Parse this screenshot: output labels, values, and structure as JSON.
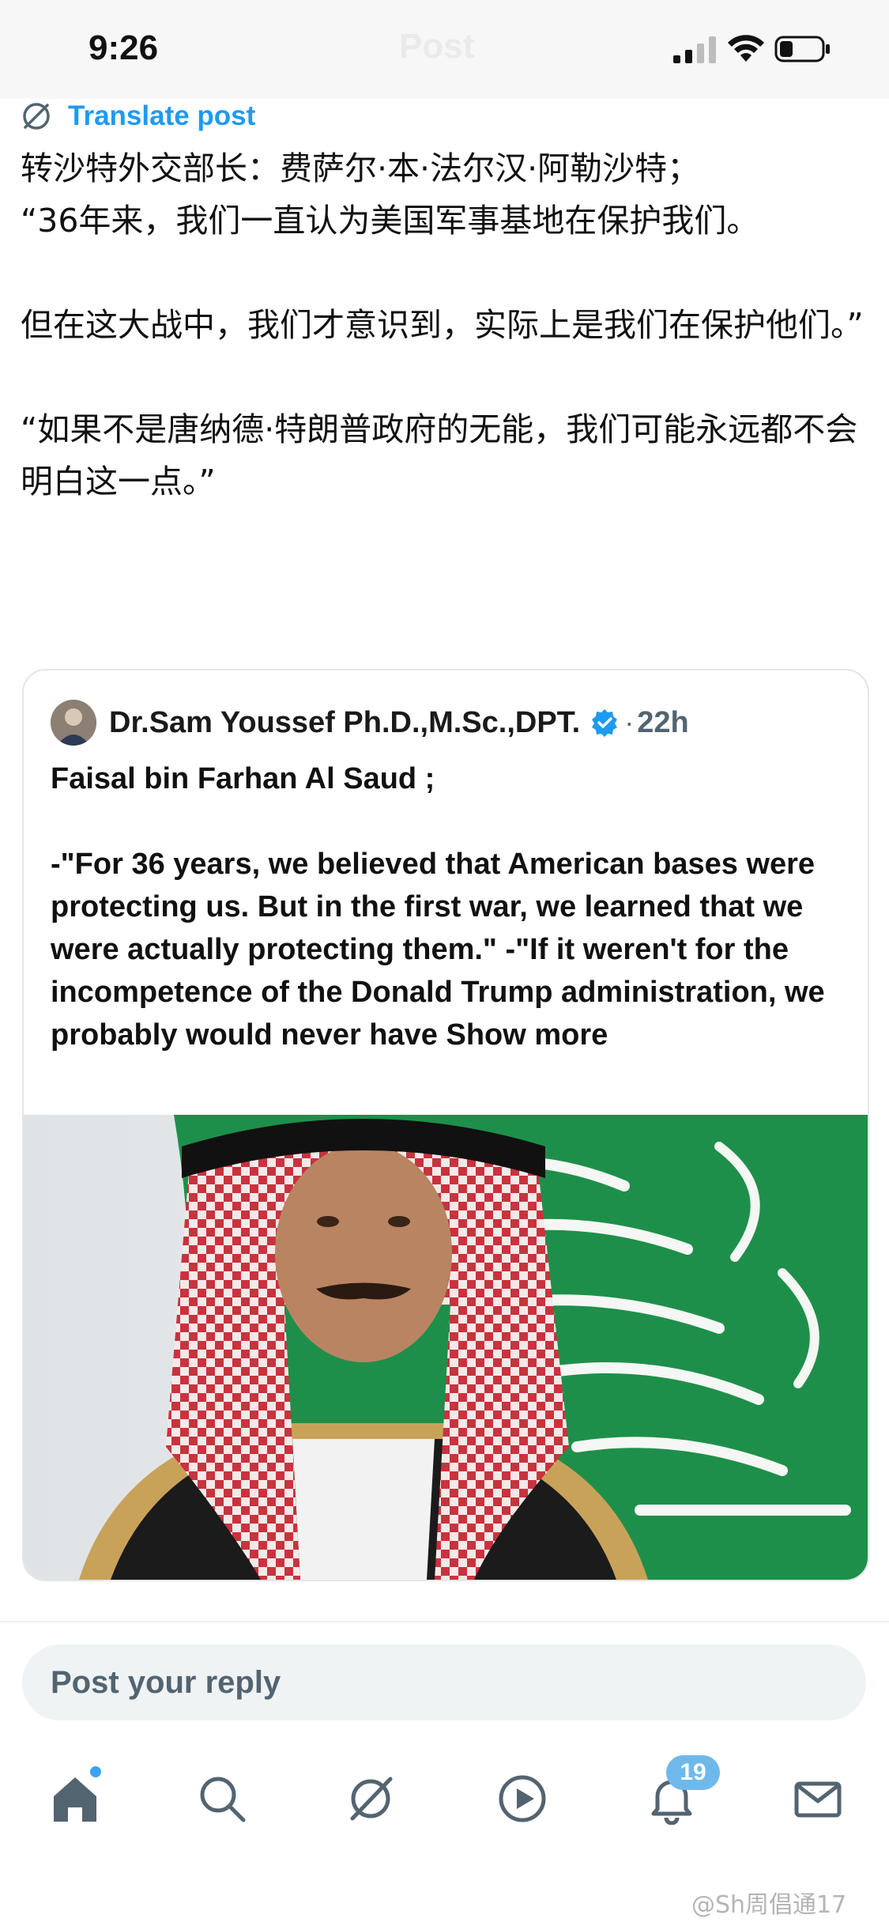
{
  "status_bar": {
    "time": "9:26",
    "title": "Post"
  },
  "translate": {
    "label": "Translate post",
    "icon": "translate-icon"
  },
  "post": {
    "lines": [
      "转沙特外交部长：费萨尔·本·法尔汉·阿勒沙特；",
      "“36年来，我们一直认为美国军事基地在保护我们。",
      "但在这大战中，我们才意识到，实际上是我们在保护他们。”",
      "“如果不是唐纳德·特朗普政府的无能，我们可能永远都不会明白这一点。”"
    ]
  },
  "quoted_post": {
    "author": "Dr.Sam Youssef Ph.D.,M.Sc.,DPT.",
    "dot": "·",
    "time": "22h",
    "title_line": "Faisal bin Farhan Al Saud ;",
    "body": "-\"For 36 years, we believed that American bases were protecting us. But in the first war, we learned that we were actually protecting them.\" -\"If it weren't for the incompetence of the Donald Trump administration, we probably would never have",
    "show_more": "Show more",
    "accent_color": "#1d9bf0"
  },
  "reply": {
    "placeholder": "Post your reply"
  },
  "bottom_nav": {
    "items": [
      "home-icon",
      "search-icon",
      "grok-icon",
      "video-icon",
      "notifications-icon",
      "messages-icon"
    ],
    "notification_count": "19"
  },
  "watermark": "@Sh周倡通17"
}
